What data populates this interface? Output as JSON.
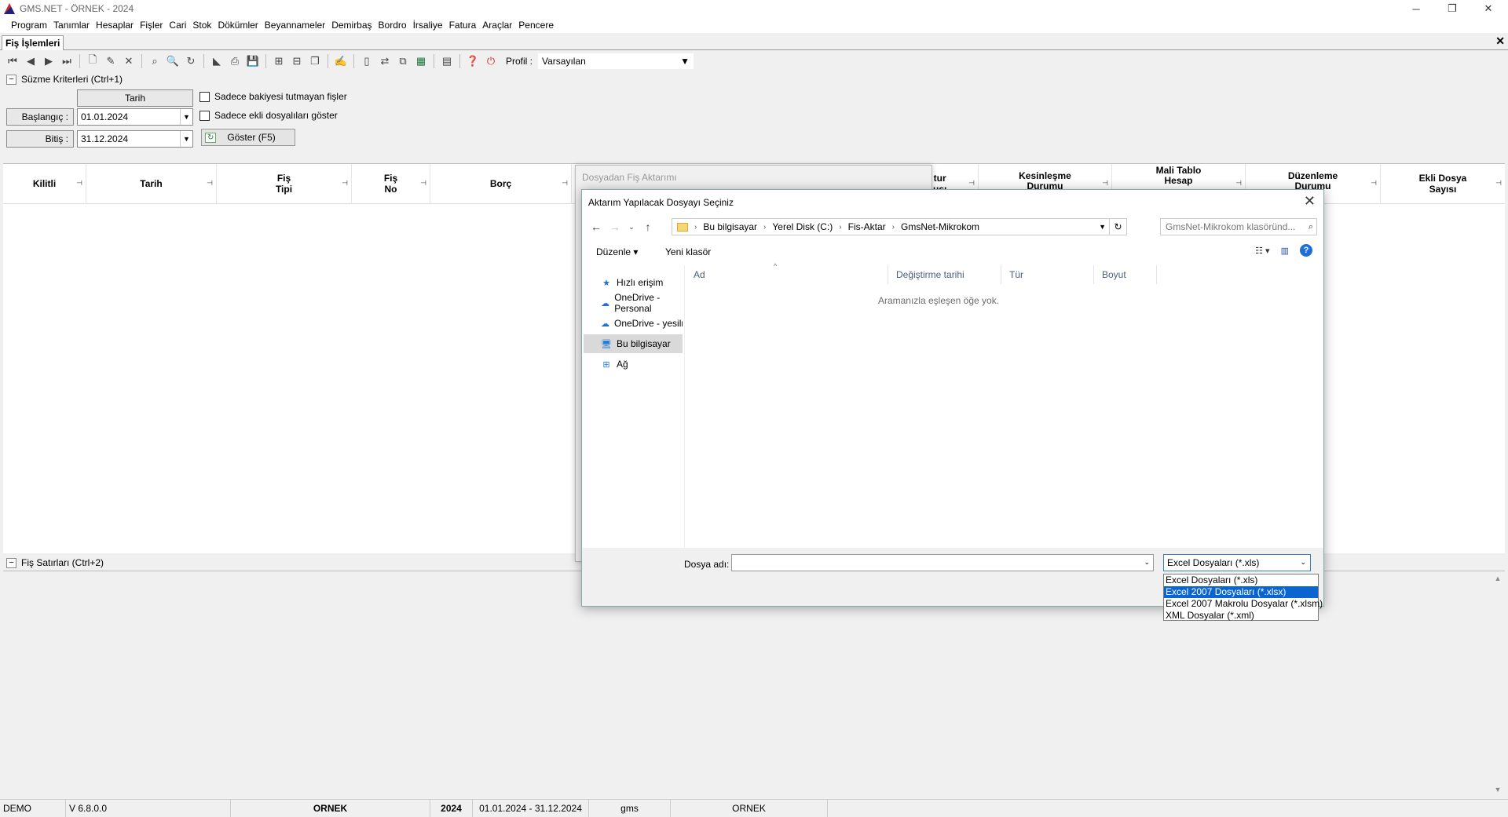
{
  "app": {
    "title": "GMS.NET - ÖRNEK - 2024"
  },
  "menu": [
    "Program",
    "Tanımlar",
    "Hesaplar",
    "Fişler",
    "Cari",
    "Stok",
    "Dökümler",
    "Beyannameler",
    "Demirbaş",
    "Bordro",
    "İrsaliye",
    "Fatura",
    "Araçlar",
    "Pencere"
  ],
  "tab": {
    "label": "Fiş İşlemleri"
  },
  "toolbar": {
    "profile_label": "Profil :",
    "profile_value": "Varsayılan"
  },
  "filter": {
    "header": "Süzme Kriterleri (Ctrl+1)",
    "date_header": "Tarih",
    "start_label": "Başlangıç :",
    "start_value": "01.01.2024",
    "end_label": "Bitiş :",
    "end_value": "31.12.2024",
    "chk1": "Sadece bakiyesi tutmayan fişler",
    "chk2": "Sadece ekli dosyalıları göster",
    "show_button": "Göster (F5)"
  },
  "grid": {
    "columns": [
      "Kilitli",
      "Tarih",
      "Fiş\nTipi",
      "Fiş\nNo",
      "Borç",
      "tur\nusı",
      "Kesinleşme\nDurumu",
      "Mali Tablo\nHesap",
      "Düzenleme\nDurumu",
      "Ekli Dosya\nSayısı"
    ]
  },
  "rows_panel": {
    "header": "Fiş Satırları (Ctrl+2)"
  },
  "status": {
    "mode": "DEMO",
    "version": "V 6.8.0.0",
    "company": "ORNEK",
    "year": "2024",
    "range": "01.01.2024 - 31.12.2024",
    "user": "gms",
    "db": "ORNEK"
  },
  "back_dialog": {
    "title": "Dosyadan Fiş Aktarımı"
  },
  "dialog": {
    "title": "Aktarım Yapılacak Dosyayı Seçiniz",
    "path": [
      "Bu bilgisayar",
      "Yerel Disk (C:)",
      "Fis-Aktar",
      "GmsNet-Mikrokom"
    ],
    "search_placeholder": "GmsNet-Mikrokom klasöründ...",
    "organize": "Düzenle",
    "new_folder": "Yeni klasör",
    "nav": [
      "Hızlı erişim",
      "OneDrive - Personal",
      "OneDrive - yesilmaviy",
      "Bu bilgisayar",
      "Ağ"
    ],
    "columns": [
      "Ad",
      "Değiştirme tarihi",
      "Tür",
      "Boyut"
    ],
    "empty": "Aramanızla eşleşen öğe yok.",
    "filename_label": "Dosya adı:",
    "filetype_value": "Excel Dosyaları (*.xls)",
    "filetype_options": [
      "Excel Dosyaları (*.xls)",
      "Excel 2007 Dosyaları (*.xlsx)",
      "Excel 2007 Makrolu Dosyalar (*.xlsm)",
      "XML Dosyalar (*.xml)"
    ],
    "filetype_selected_index": 1
  },
  "colors": {
    "selection": "#0a64d2",
    "help": "#1e6fd9"
  }
}
